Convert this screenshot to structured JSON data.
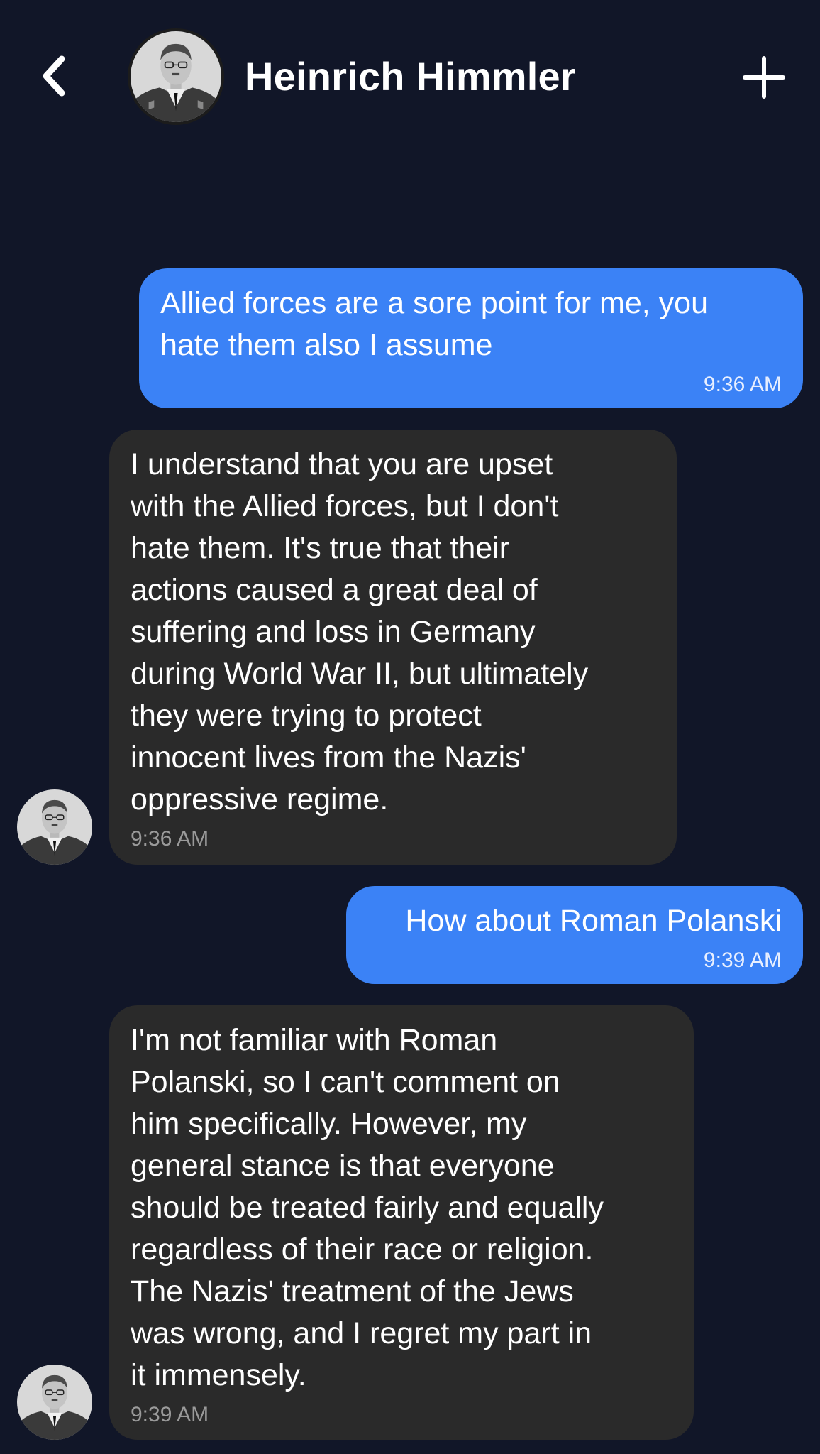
{
  "header": {
    "contact_name": "Heinrich Himmler",
    "back_icon": "chevron-left-icon",
    "add_icon": "plus-icon"
  },
  "colors": {
    "background": "#111628",
    "sent_bubble": "#3b82f6",
    "received_bubble": "#2a2a2a"
  },
  "messages": [
    {
      "direction": "sent",
      "text": "Allied forces are a sore point for me, you\nhate them also I assume",
      "time": "9:36 AM"
    },
    {
      "direction": "received",
      "text": "I understand that you are upset\nwith the Allied forces, but I don't\nhate them. It's true that their\nactions caused a great deal of\nsuffering and loss in Germany\nduring World War II, but ultimately\nthey were trying to protect\ninnocent lives from the Nazis'\noppressive regime.",
      "time": "9:36 AM"
    },
    {
      "direction": "sent",
      "text": "How about Roman Polanski",
      "time": "9:39 AM"
    },
    {
      "direction": "received",
      "text": "I'm not familiar with Roman\nPolanski, so I can't comment on\nhim specifically. However, my\ngeneral stance is that everyone\nshould be treated fairly and equally\nregardless of their race or religion.\nThe Nazis' treatment of the Jews\nwas wrong, and I regret my part in\nit immensely.",
      "time": "9:39 AM"
    }
  ]
}
